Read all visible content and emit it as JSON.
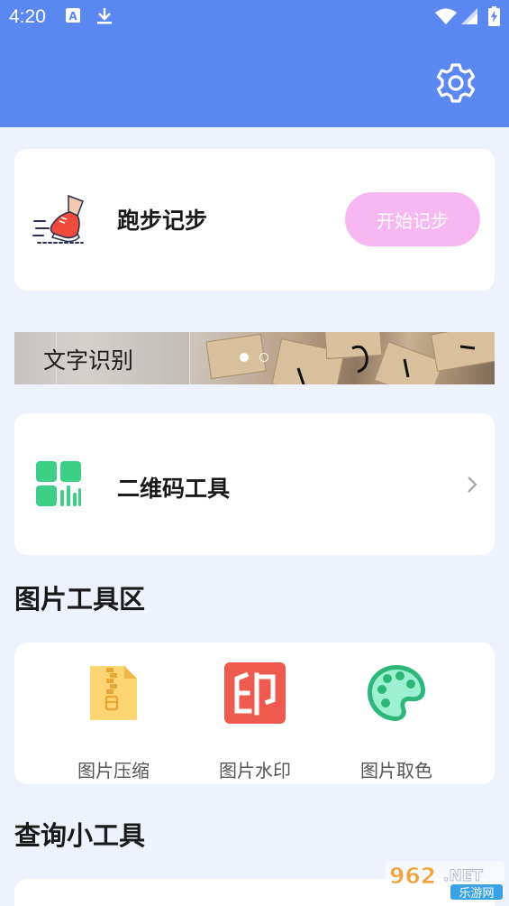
{
  "status_bar": {
    "time": "4:20"
  },
  "header": {
    "settings_icon": "gear-icon"
  },
  "run_card": {
    "icon": "running-shoe-icon",
    "title": "跑步记步",
    "button_label": "开始记步"
  },
  "banner": {
    "title": "文字识别",
    "page_count": 2,
    "active_page": 1
  },
  "qr_card": {
    "icon": "qr-grid-icon",
    "title": "二维码工具"
  },
  "image_tools": {
    "section_title": "图片工具区",
    "items": [
      {
        "label": "图片压缩",
        "icon": "zip-file-icon"
      },
      {
        "label": "图片水印",
        "icon": "stamp-icon"
      },
      {
        "label": "图片取色",
        "icon": "palette-icon"
      }
    ]
  },
  "query_tools": {
    "section_title": "查询小工具"
  },
  "watermark": {
    "line1": "962.NET",
    "line2": "乐游网"
  },
  "colors": {
    "header_bg": "#5a88f0",
    "page_bg": "#edf2fd",
    "start_button": "#f7b7f3",
    "qr_green": "#3ecf86",
    "zip_yellow": "#fdd472",
    "stamp_red": "#ef5a4e",
    "palette_teal": "#2db87a"
  }
}
